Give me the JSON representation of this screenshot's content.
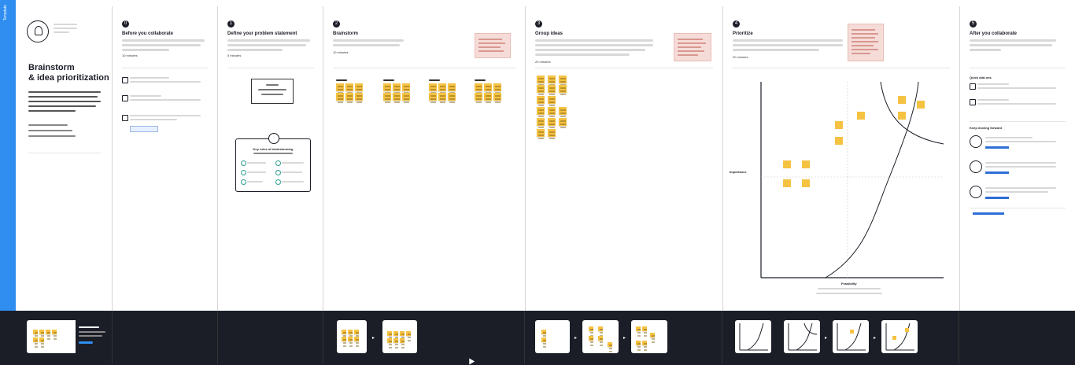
{
  "board": {
    "tab_label": "Template"
  },
  "intro": {
    "title_line1": "Brainstorm",
    "title_line2": "& idea prioritization"
  },
  "sheets": [
    {
      "number": "0",
      "heading": "Before you collaborate",
      "time": "10 minutes"
    },
    {
      "number": "1",
      "heading": "Define your problem statement",
      "time": "5 minutes"
    },
    {
      "number": "2",
      "heading": "Brainstorm",
      "time": "10 minutes"
    },
    {
      "number": "3",
      "heading": "Group ideas",
      "time": "20 minutes"
    },
    {
      "number": "4",
      "heading": "Prioritize",
      "time": "20 minutes"
    },
    {
      "number": "5",
      "heading": "After you collaborate"
    }
  ],
  "brainstorm_card": {
    "title": "Key rules of brainstorming"
  },
  "prioritize": {
    "y_axis": "Importance",
    "x_axis": "Feasibility"
  },
  "after": {
    "quick_add_ons": "Quick add-ons",
    "keep_moving": "Keep moving forward"
  },
  "colors": {
    "accent": "#2f8ef0",
    "sticky": "#f5c242",
    "dark": "#1b1e27",
    "pink": "#f6dcd8"
  }
}
